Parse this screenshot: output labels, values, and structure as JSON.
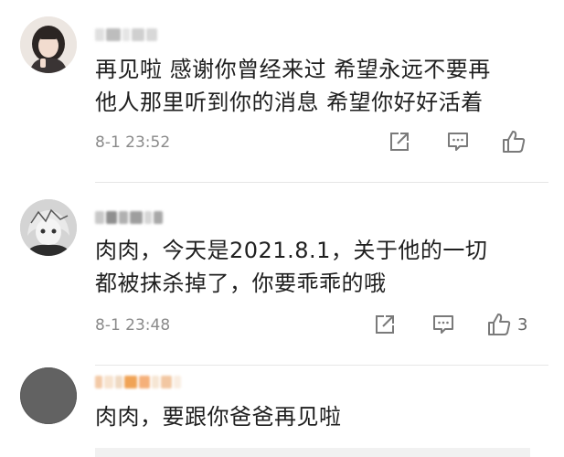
{
  "comments": [
    {
      "username_masked": true,
      "text_line1": "再见啦 感谢你曾经来过 希望永远不要再",
      "text_line2": "他人那里听到你的消息 希望你好好活着",
      "time": "8-1 23:52",
      "like_count": ""
    },
    {
      "username_masked": true,
      "text_line1": "肉肉，今天是2021.8.1，关于他的一切",
      "text_line2": "都被抹杀掉了，你要乖乖的哦",
      "time": "8-1 23:48",
      "like_count": "3"
    },
    {
      "username_masked": true,
      "text_line1": "肉肉，要跟你爸爸再见啦",
      "text_line2": "",
      "time": "",
      "like_count": ""
    }
  ],
  "icons": {
    "share": "share-icon",
    "comment": "comment-icon",
    "like": "thumbs-up-icon"
  },
  "colors": {
    "text": "#1f1f1f",
    "meta": "#8a8a8a",
    "icon": "#7a7a7a"
  }
}
